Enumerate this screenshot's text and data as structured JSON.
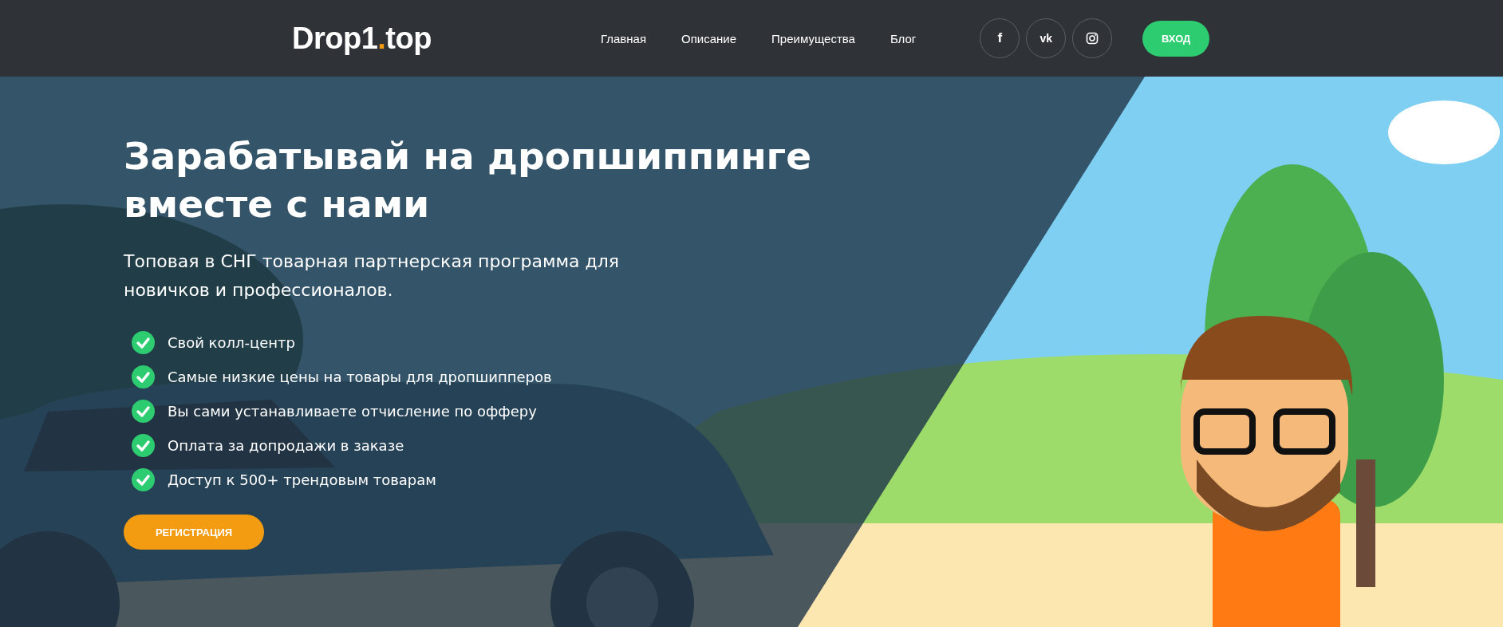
{
  "header": {
    "logo": {
      "main": "Drop1",
      "dot": ".",
      "tail": "top"
    },
    "nav": [
      {
        "label": "Главная"
      },
      {
        "label": "Описание"
      },
      {
        "label": "Преимущества"
      },
      {
        "label": "Блог"
      }
    ],
    "social": [
      {
        "kind": "facebook",
        "label": "f"
      },
      {
        "kind": "vk",
        "label": "vk"
      },
      {
        "kind": "instagram"
      }
    ],
    "login_button": "ВХОД"
  },
  "hero": {
    "title": "Зарабатывай на дропшиппинге вместе с нами",
    "subtitle": "Топовая в СНГ товарная партнерская программа для новичков и профессионалов.",
    "features": [
      {
        "text": "Свой колл-центр"
      },
      {
        "text": "Самые низкие цены на товары для дропшипперов"
      },
      {
        "text": "Вы сами устанавливаете отчисление по офферу"
      },
      {
        "text": "Оплата за допродажи в заказе"
      },
      {
        "text": "Доступ к 500+ трендовым товарам"
      }
    ],
    "register_button": "РЕГИСТРАЦИЯ"
  }
}
